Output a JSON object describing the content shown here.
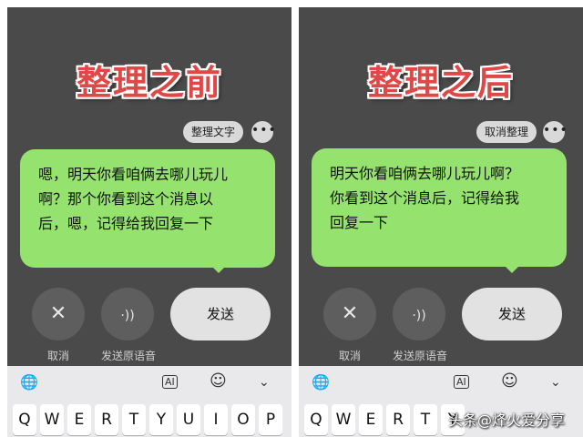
{
  "left": {
    "title": "整理之前",
    "action_pill": "整理文字",
    "more": "•••",
    "message_lines": [
      "嗯，明天你看咱俩去哪儿玩儿",
      "啊？那个你看到这个消息以",
      "后，嗯，记得给我回复一下"
    ],
    "cancel_icon": "✕",
    "voice_icon": "·))",
    "send_label": "发送",
    "cancel_caption": "取消",
    "voice_caption": "发送原语音"
  },
  "right": {
    "title": "整理之后",
    "action_pill": "取消整理",
    "more": "•••",
    "message_lines": [
      "明天你看咱俩去哪儿玩儿啊？",
      "你看到这个消息后，记得给我",
      "回复一下"
    ],
    "cancel_icon": "✕",
    "voice_icon": "·))",
    "send_label": "发送",
    "cancel_caption": "取消",
    "voice_caption": "发送原语音"
  },
  "keyboard": {
    "globe": "🌐",
    "ai": "AI",
    "emoji": "☺",
    "chevron": "⌄",
    "row_left": [
      "Q",
      "W",
      "E",
      "R",
      "T",
      "Y",
      "U",
      "I",
      "O",
      "P"
    ],
    "row_right": [
      "Q",
      "W",
      "E",
      "R",
      "T",
      "Y"
    ]
  },
  "watermark": "头条@烽火爱分享",
  "colors": {
    "accent_title": "#e04848",
    "bubble": "#95e26e",
    "panel_bg": "#4a4a4a"
  }
}
